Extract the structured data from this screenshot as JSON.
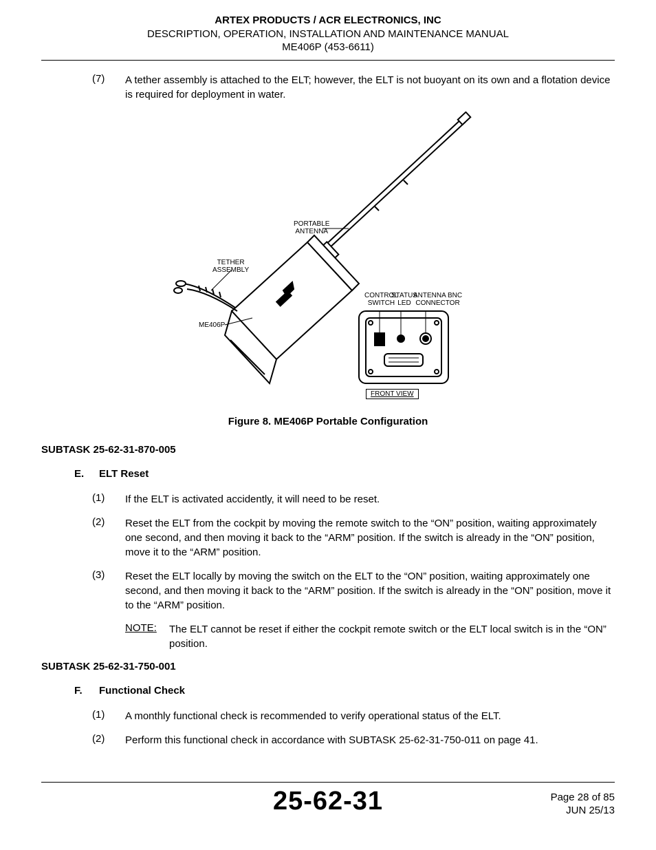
{
  "header": {
    "company": "ARTEX PRODUCTS / ACR ELECTRONICS, INC",
    "manual": "DESCRIPTION, OPERATION, INSTALLATION AND MAINTENANCE MANUAL",
    "model": "ME406P (453-6611)"
  },
  "item7": {
    "num": "(7)",
    "text": "A tether assembly is attached to the ELT; however, the ELT is not buoyant on its own and a flotation device is required for deployment in water."
  },
  "diagram": {
    "portable_antenna": "PORTABLE\nANTENNA",
    "tether_assembly": "TETHER\nASSEMBLY",
    "me406p": "ME406P",
    "control_switch": "CONTROL\nSWITCH",
    "status_led": "STATUS\nLED",
    "antenna_bnc_connector": "ANTENNA BNC\nCONNECTOR",
    "front_view": "FRONT VIEW"
  },
  "figure_caption": "Figure 8.  ME406P Portable Configuration",
  "subtask_e": "SUBTASK 25-62-31-870-005",
  "section_e": {
    "letter": "E.",
    "title": "ELT Reset",
    "items": [
      {
        "num": "(1)",
        "text": "If the ELT is activated accidently, it will need to be reset."
      },
      {
        "num": "(2)",
        "text": "Reset the ELT from the cockpit by moving the remote switch to the “ON” position, waiting approximately one second, and then moving it back to the “ARM” position. If the switch is already in the “ON” position, move it to the “ARM” position."
      },
      {
        "num": "(3)",
        "text": "Reset the ELT locally by moving the switch on the ELT to the “ON” position, waiting approximately one second, and then moving it back to the “ARM” position. If the switch is already in the “ON” position, move it to the “ARM” position."
      }
    ],
    "note_label": "NOTE:",
    "note_body": "The ELT cannot be reset if either the cockpit remote switch or the ELT local switch is in the “ON” position."
  },
  "subtask_f": "SUBTASK 25-62-31-750-001",
  "section_f": {
    "letter": "F.",
    "title": "Functional Check",
    "items": [
      {
        "num": "(1)",
        "text": "A monthly functional check is recommended to verify operational status of the ELT."
      },
      {
        "num": "(2)",
        "text": "Perform this functional check in accordance with SUBTASK 25-62-31-750-011 on page 41."
      }
    ]
  },
  "footer": {
    "code": "25-62-31",
    "page": "Page 28 of 85",
    "date": "JUN 25/13"
  }
}
